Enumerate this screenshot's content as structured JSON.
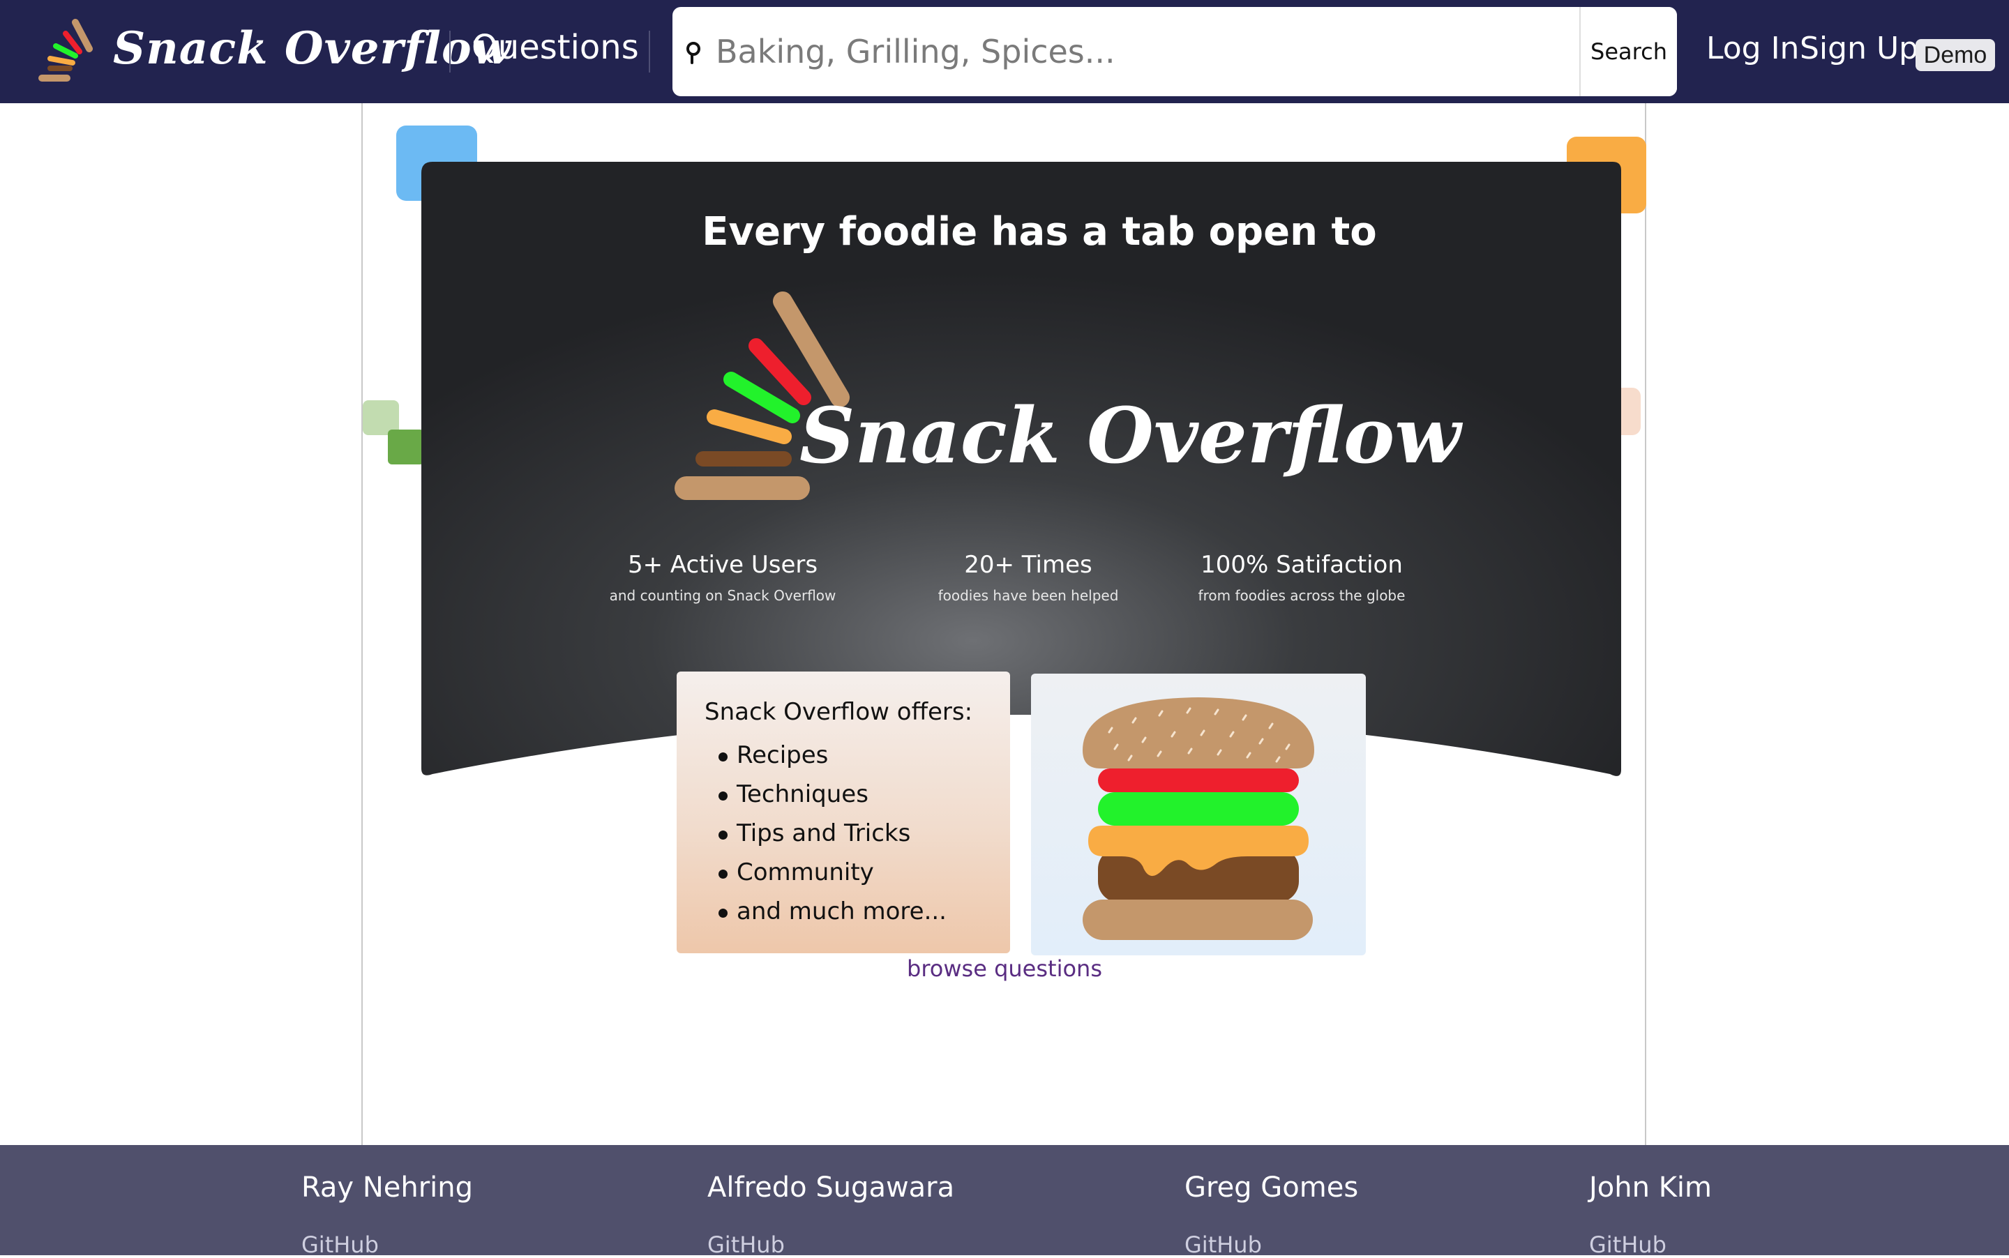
{
  "header": {
    "logo_text": "Snack Overflow",
    "nav_questions": "Questions",
    "search_placeholder": "Baking, Grilling, Spices...",
    "search_button": "Search",
    "login": "Log In",
    "signup": "Sign Up",
    "demo": "Demo"
  },
  "hero": {
    "heading": "Every foodie has a tab open to",
    "logo_text": "Snack Overflow",
    "stats": [
      {
        "value": "5+ Active Users",
        "caption": "and counting on Snack Overflow"
      },
      {
        "value": "20+ Times",
        "caption": "foodies have been helped"
      },
      {
        "value": "100% Satifaction",
        "caption": "from foodies across the globe"
      }
    ]
  },
  "offers": {
    "title": "Snack Overflow offers:",
    "items": [
      "Recipes",
      "Techniques",
      "Tips and Tricks",
      "Community",
      "and much more..."
    ]
  },
  "browse_link": "browse questions",
  "footer": {
    "people": [
      {
        "name": "Ray Nehring",
        "link": "GitHub"
      },
      {
        "name": "Alfredo Sugawara",
        "link": "GitHub"
      },
      {
        "name": "Greg Gomes",
        "link": "GitHub"
      },
      {
        "name": "John Kim",
        "link": "GitHub"
      }
    ]
  },
  "colors": {
    "navbar": "#22234f",
    "footer": "#50506c",
    "hero_dark": "#25272a",
    "bun": "#c4976b",
    "tomato": "#ee1f2d",
    "lettuce": "#22f22b",
    "cheese": "#f9ac44",
    "patty": "#7a4a25",
    "deco_blue": "#6cbaf3",
    "deco_orange": "#f9ac44",
    "deco_green_light": "#c2dcb0",
    "deco_green_dark": "#69a947",
    "deco_peach": "#f7dccc",
    "link": "#5a2d82"
  }
}
